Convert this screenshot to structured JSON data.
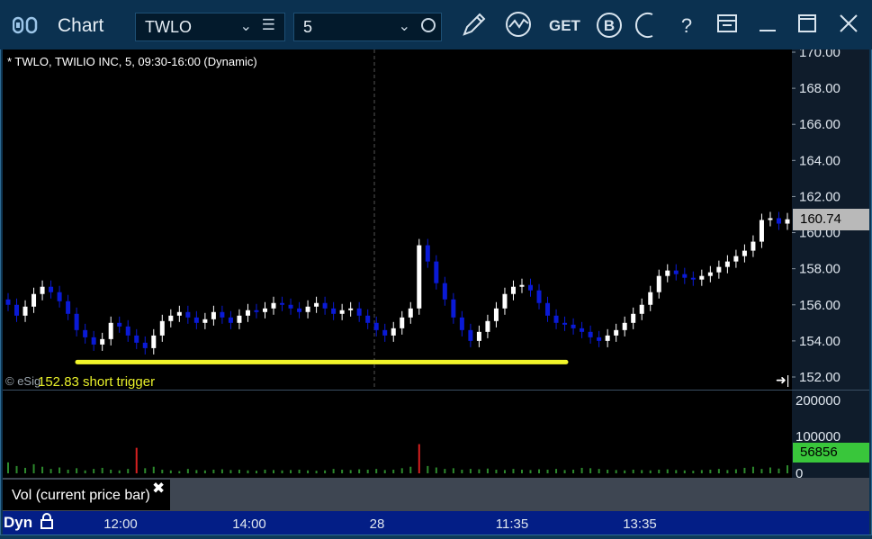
{
  "window": {
    "title": "Chart",
    "title_icon": "chart-app-icon",
    "symbol": "TWLO",
    "interval": "5"
  },
  "toolbar": {
    "icons": [
      "draw-pencil-icon",
      "studies-icon",
      "get-icon",
      "b-icon",
      "half-circle-icon",
      "help-icon",
      "layout-icon",
      "minimize-icon",
      "maximize-icon",
      "close-icon"
    ],
    "get_label": "GET",
    "b_label": "B",
    "help_label": "?"
  },
  "chart": {
    "header": "* TWLO, TWILIO INC, 5, 09:30-16:00 (Dynamic)",
    "trigger_label": "152.83 short trigger",
    "watermark": "© eSig",
    "current_price": "160.74",
    "current_volume": "56856",
    "vol_panel_label": "Vol (current price bar)",
    "footer_mode": "Dyn"
  },
  "chart_data": {
    "type": "line",
    "title": "* TWLO, TWILIO INC, 5, 09:30-16:00 (Dynamic)",
    "price_ticks": [
      "170.00",
      "168.00",
      "166.00",
      "164.00",
      "162.00",
      "160.00",
      "158.00",
      "156.00",
      "154.00",
      "152.00"
    ],
    "volume_ticks": [
      "200000",
      "100000",
      "0"
    ],
    "time_ticks": [
      "12:00",
      "14:00",
      "28",
      "11:35",
      "13:35"
    ],
    "ylim": [
      151.6,
      170.0
    ],
    "horizontal_line": {
      "value": 152.83,
      "color": "#f2f52a",
      "label": "152.83 short trigger"
    },
    "series": [
      {
        "values": [
          156.0,
          155.4,
          155.9,
          156.6,
          157.0,
          156.7,
          156.2,
          155.5,
          154.6,
          154.2,
          153.8,
          154.1,
          155.0,
          154.8,
          154.3,
          153.9,
          153.6,
          154.3,
          155.1,
          155.4,
          155.6,
          155.3,
          155.0,
          155.2,
          155.6,
          155.3,
          155.0,
          155.4,
          155.7,
          155.6,
          155.8,
          156.1,
          156.0,
          155.8,
          155.6,
          155.9,
          156.1,
          155.8,
          155.5,
          155.7,
          155.8,
          155.4,
          155.0,
          154.6,
          154.3,
          154.7,
          155.3,
          155.8,
          159.3,
          158.4,
          157.2,
          156.3,
          155.3,
          154.6,
          154.0,
          154.5,
          155.1,
          155.8,
          156.6,
          157.0,
          157.1,
          156.8,
          156.1,
          155.4,
          155.0,
          154.9,
          154.7,
          154.5,
          154.2,
          154.0,
          154.3,
          154.6,
          155.0,
          155.5,
          156.0,
          156.7,
          157.6,
          157.9,
          157.7,
          157.5,
          157.4,
          157.6,
          157.8,
          158.1,
          158.4,
          158.7,
          159.0,
          159.5,
          160.7,
          160.8,
          160.5,
          160.74
        ],
        "color": "#ffffff"
      }
    ],
    "volume_values": [
      30,
      20,
      15,
      25,
      18,
      12,
      16,
      10,
      14,
      8,
      12,
      15,
      10,
      8,
      12,
      70,
      14,
      18,
      10,
      8,
      6,
      12,
      9,
      8,
      10,
      11,
      9,
      10,
      8,
      7,
      10,
      9,
      8,
      9,
      10,
      8,
      7,
      8,
      12,
      10,
      9,
      11,
      10,
      12,
      9,
      10,
      14,
      18,
      80,
      20,
      16,
      12,
      14,
      10,
      12,
      11,
      13,
      10,
      9,
      12,
      10,
      9,
      11,
      10,
      12,
      9,
      10,
      15,
      14,
      12,
      10,
      9,
      8,
      10,
      9,
      8,
      10,
      11,
      9,
      8,
      7,
      9,
      10,
      12,
      9,
      11,
      15,
      18,
      12,
      16,
      13,
      22
    ],
    "grid": false
  },
  "colors": {
    "up_candle": "#ffffff",
    "down_candle": "#0a1ad6",
    "trigger": "#f2f52a",
    "vol_spike": "#d62020",
    "vol_normal": "#2d8a2d"
  }
}
